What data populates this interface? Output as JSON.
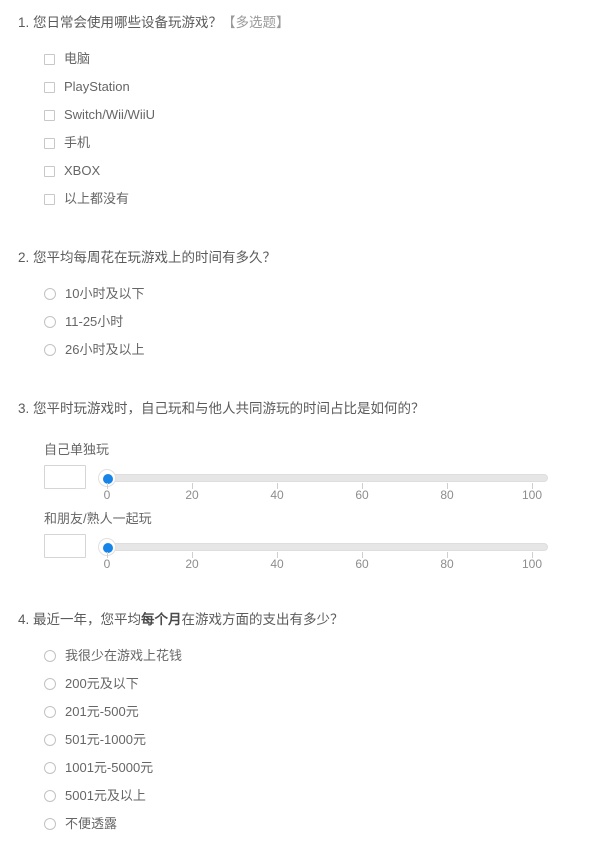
{
  "survey": {
    "required_marker": "*",
    "questions": [
      {
        "number": "1.",
        "title": "您日常会使用哪些设备玩游戏？",
        "tag": "【多选题】",
        "type": "checkbox",
        "options": [
          {
            "label": "电脑"
          },
          {
            "label": "PlayStation"
          },
          {
            "label": "Switch/Wii/WiiU"
          },
          {
            "label": "手机"
          },
          {
            "label": "XBOX"
          },
          {
            "label": "以上都没有"
          }
        ]
      },
      {
        "number": "2.",
        "title": "您平均每周花在玩游戏上的时间有多久？",
        "tag": "",
        "type": "radio",
        "options": [
          {
            "label": "10小时及以下"
          },
          {
            "label": "11-25小时"
          },
          {
            "label": "26小时及以上"
          }
        ]
      },
      {
        "number": "3.",
        "title": "您平时玩游戏时，自己玩和与他人共同游玩的时间占比是如何的？",
        "tag": "",
        "type": "slider",
        "sliders": [
          {
            "name": "自己单独玩",
            "value": "",
            "placeholder": "",
            "min": 0,
            "max": 100,
            "current": 0,
            "ticks": [
              "0",
              "20",
              "40",
              "60",
              "80",
              "100"
            ]
          },
          {
            "name": "和朋友/熟人一起玩",
            "value": "",
            "placeholder": "",
            "min": 0,
            "max": 100,
            "current": 0,
            "ticks": [
              "0",
              "20",
              "40",
              "60",
              "80",
              "100"
            ]
          }
        ]
      },
      {
        "number": "4.",
        "title_pre": "最近一年，您平均",
        "title_strong": "每个月",
        "title_post": "在游戏方面的支出有多少？",
        "tag": "",
        "type": "radio",
        "options": [
          {
            "label": "我很少在游戏上花钱"
          },
          {
            "label": "200元及以下"
          },
          {
            "label": "201元-500元"
          },
          {
            "label": "501元-1000元"
          },
          {
            "label": "1001元-5000元"
          },
          {
            "label": "5001元及以上"
          },
          {
            "label": "不便透露"
          }
        ]
      }
    ]
  },
  "colors": {
    "accent": "#1784e8",
    "required": "#e8524a",
    "text": "#666666",
    "track": "#e6e6e6"
  }
}
